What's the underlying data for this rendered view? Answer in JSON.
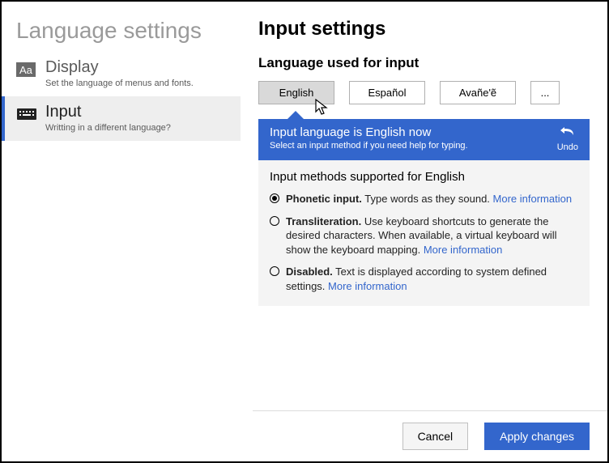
{
  "sidebar": {
    "title": "Language settings",
    "items": [
      {
        "label": "Display",
        "desc": "Set the language of menus and fonts."
      },
      {
        "label": "Input",
        "desc": "Writting in a different language?"
      }
    ]
  },
  "main": {
    "title": "Input settings",
    "section_title": "Language used for input",
    "languages": [
      "English",
      "Español",
      "Avañe'ẽ"
    ],
    "more_label": "...",
    "callout": {
      "title": "Input language is English now",
      "sub": "Select an input method if you need help for typing.",
      "undo": "Undo"
    },
    "methods_title": "Input methods supported for English",
    "methods": [
      {
        "name": "Phonetic input.",
        "desc": " Type words as they sound. ",
        "link": "More information"
      },
      {
        "name": "Transliteration.",
        "desc": " Use keyboard shortcuts to generate the desired characters. When available, a virtual keyboard will show the keyboard mapping. ",
        "link": "More information"
      },
      {
        "name": "Disabled.",
        "desc": " Text is displayed according to system defined settings. ",
        "link": "More information"
      }
    ]
  },
  "footer": {
    "cancel": "Cancel",
    "apply": "Apply changes"
  }
}
